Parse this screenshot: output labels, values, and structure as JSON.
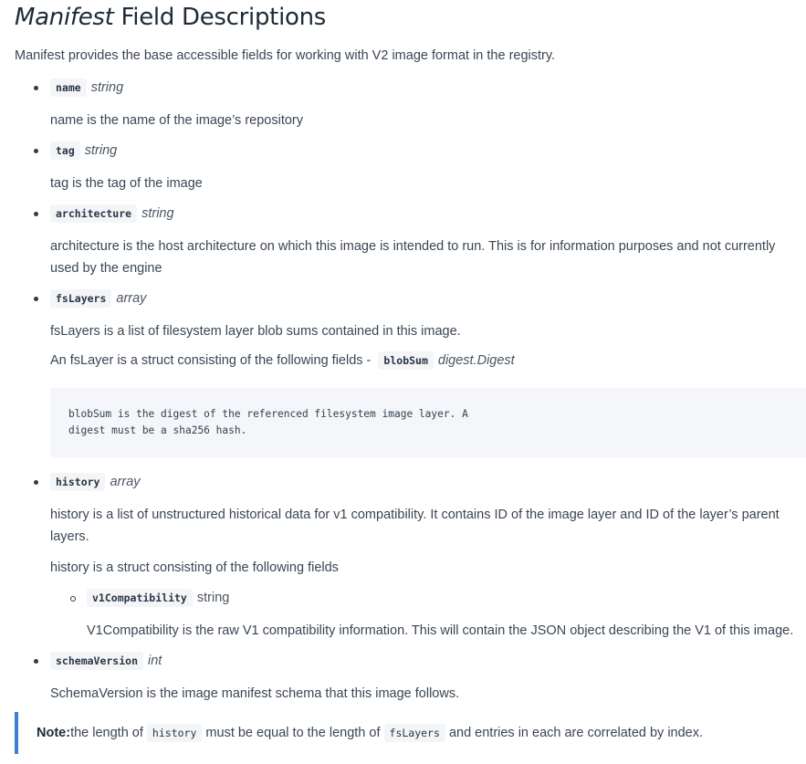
{
  "title_italic": "Manifest",
  "title_rest": "Field Descriptions",
  "intro": "Manifest provides the base accessible fields for working with V2 image format in the registry.",
  "fields": {
    "name": {
      "code": "name",
      "type": "string",
      "desc": "name is the name of the image’s repository"
    },
    "tag": {
      "code": "tag",
      "type": "string",
      "desc": "tag is the tag of the image"
    },
    "architecture": {
      "code": "architecture",
      "type": "string",
      "desc": "architecture is the host architecture on which this image is intended to run. This is for information purposes and not currently used by the engine"
    },
    "fslayers": {
      "code": "fsLayers",
      "type": "array",
      "desc": "fsLayers is a list of filesystem layer blob sums contained in this image.",
      "struct_prefix": "An fsLayer is a struct consisting of the following fields -",
      "sub_code": "blobSum",
      "sub_type": "digest.Digest",
      "codeblock": "blobSum is the digest of the referenced filesystem image layer. A\ndigest must be a sha256 hash."
    },
    "history": {
      "code": "history",
      "type": "array",
      "desc": "history is a list of unstructured historical data for v1 compatibility. It contains ID of the image layer and ID of the layer’s parent layers.",
      "struct_text": "history is a struct consisting of the following fields",
      "sub_code": "v1Compatibility",
      "sub_type": "string",
      "sub_desc": "V1Compatibility is the raw V1 compatibility information. This will contain the JSON object describing the V1 of this image."
    },
    "schemaversion": {
      "code": "schemaVersion",
      "type": "int",
      "desc": "SchemaVersion is the image manifest schema that this image follows."
    }
  },
  "note": {
    "label": "Note:",
    "text1": "the length of",
    "code1": "history",
    "text2": "must be equal to the length of",
    "code2": "fsLayers",
    "text3": "and entries in each are correlated by index."
  },
  "colors": {
    "accent_border": "#3f7fd3",
    "code_bg": "#f3f5f7",
    "text": "#3a4553"
  }
}
